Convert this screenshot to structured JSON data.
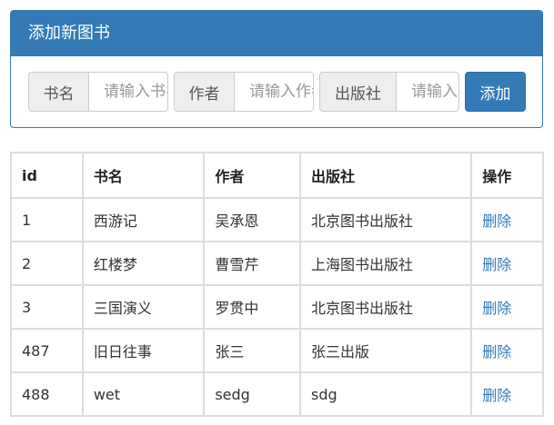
{
  "panel": {
    "title": "添加新图书",
    "fields": [
      {
        "label": "书名",
        "placeholder": "请输入书名"
      },
      {
        "label": "作者",
        "placeholder": "请输入作者"
      },
      {
        "label": "出版社",
        "placeholder": "请输入出版社"
      }
    ],
    "add_label": "添加"
  },
  "table": {
    "headers": [
      "id",
      "书名",
      "作者",
      "出版社",
      "操作"
    ],
    "rows": [
      {
        "id": "1",
        "name": "西游记",
        "author": "吴承恩",
        "publisher": "北京图书出版社",
        "action": "删除"
      },
      {
        "id": "2",
        "name": "红楼梦",
        "author": "曹雪芹",
        "publisher": "上海图书出版社",
        "action": "删除"
      },
      {
        "id": "3",
        "name": "三国演义",
        "author": "罗贯中",
        "publisher": "北京图书出版社",
        "action": "删除"
      },
      {
        "id": "487",
        "name": "旧日往事",
        "author": "张三",
        "publisher": "张三出版",
        "action": "删除"
      },
      {
        "id": "488",
        "name": "wet",
        "author": "sedg",
        "publisher": "sdg",
        "action": "删除"
      }
    ]
  },
  "colors": {
    "primary": "#337ab7",
    "border": "#dddddd",
    "addon_bg": "#eeeeee"
  }
}
